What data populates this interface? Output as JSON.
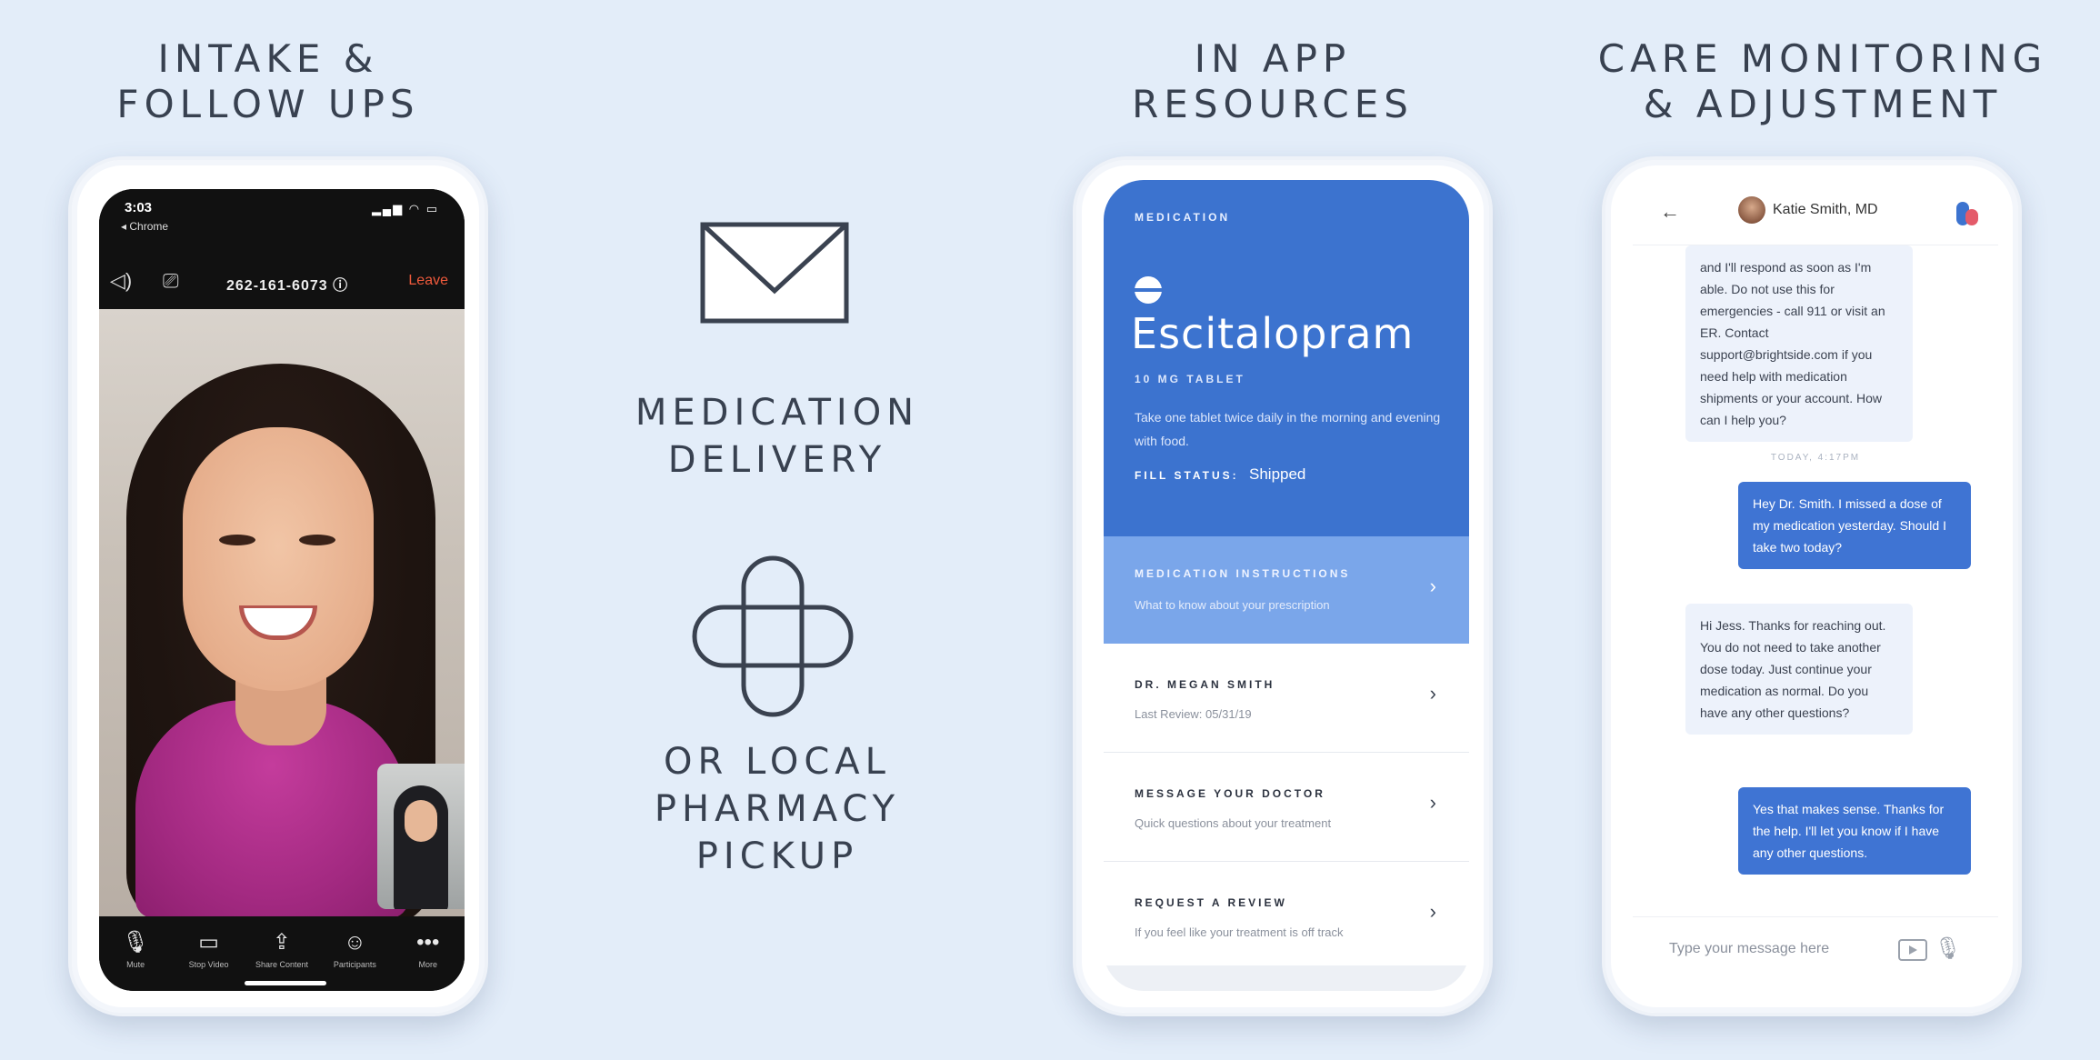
{
  "headings": {
    "intake": [
      "INTAKE &",
      "FOLLOW UPS"
    ],
    "resources": [
      "IN APP",
      "RESOURCES"
    ],
    "care": [
      "CARE MONITORING",
      "& ADJUSTMENT"
    ],
    "delivery": [
      "MEDICATION",
      "DELIVERY"
    ],
    "pickup": [
      "OR LOCAL",
      "PHARMACY",
      "PICKUP"
    ]
  },
  "video_call": {
    "time": "3:03",
    "back_label": "◂ Chrome",
    "signal": "▂▄▆ ◠ ▭",
    "meeting_id": "262-161-6073 ⓘ",
    "leave_label": "Leave",
    "controls": [
      {
        "icon": "🎙",
        "label": "Mute"
      },
      {
        "icon": "▭",
        "label": "Stop Video"
      },
      {
        "icon": "⇪",
        "label": "Share Content"
      },
      {
        "icon": "☺",
        "label": "Participants"
      },
      {
        "icon": "•••",
        "label": "More"
      }
    ]
  },
  "medication": {
    "category": "MEDICATION",
    "name": "Escitalopram",
    "dose": "10 MG TABLET",
    "description": "Take one tablet twice daily in the morning and evening with food.",
    "fill_status_label": "FILL STATUS:",
    "fill_status_value": "Shipped",
    "instructions": {
      "title": "MEDICATION INSTRUCTIONS",
      "subtitle": "What to know about your prescription"
    },
    "rows": [
      {
        "title": "DR. MEGAN SMITH",
        "subtitle": "Last Review: 05/31/19"
      },
      {
        "title": "MESSAGE YOUR DOCTOR",
        "subtitle": "Quick questions about your treatment"
      },
      {
        "title": "REQUEST A REVIEW",
        "subtitle": "If you feel like your treatment is off track"
      }
    ]
  },
  "chat": {
    "doctor_name": "Katie Smith, MD",
    "messages": [
      {
        "from": "doctor",
        "text": "and I'll respond as soon as I'm able. Do not use this for emergencies - call 911 or visit an ER. Contact support@brightside.com if you need help with medication shipments or your account. How can I help you?"
      },
      {
        "from": "patient",
        "text": "Hey Dr. Smith. I missed a dose of my medication yesterday. Should I take two today?"
      },
      {
        "from": "doctor",
        "text": "Hi Jess. Thanks for reaching out. You do not need to take another dose today. Just continue your medication as normal. Do you have any other questions?"
      },
      {
        "from": "patient",
        "text": "Yes that makes sense. Thanks for the help. I'll let you know if I have any other questions."
      }
    ],
    "day_label": "TODAY, 4:17PM",
    "input_placeholder": "Type your message here"
  }
}
